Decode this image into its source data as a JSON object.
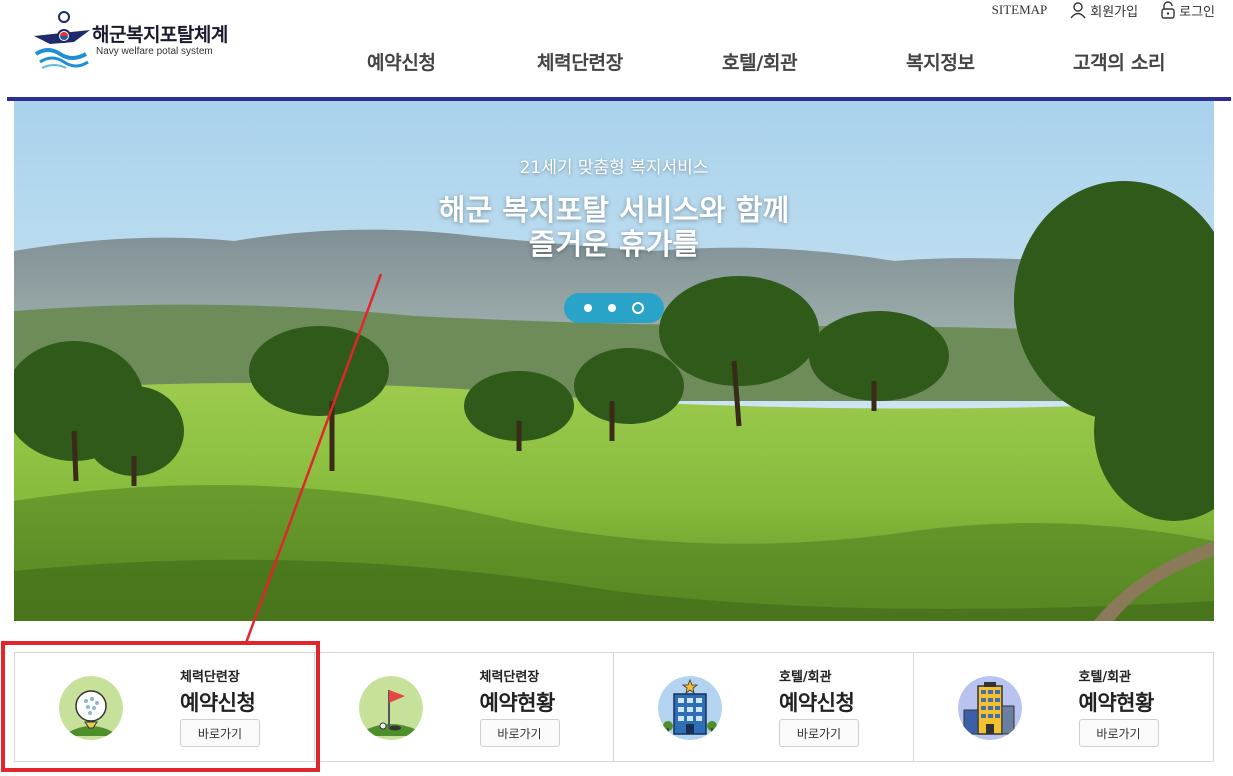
{
  "header": {
    "logo_title": "해군복지포탈체계",
    "logo_subtitle": "Navy welfare potal system",
    "util": {
      "sitemap": "SITEMAP",
      "join": "회원가입",
      "login": "로그인"
    },
    "gnb": [
      "예약신청",
      "체력단련장",
      "호텔/회관",
      "복지정보",
      "고객의 소리"
    ]
  },
  "hero": {
    "subtitle": "21세기 맞춤형 복지서비스",
    "title_line1": "해군 복지포탈 서비스와 함께",
    "title_line2": "즐거운 휴가를",
    "slides_total": 3,
    "slide_active": 3
  },
  "cards": [
    {
      "category": "체력단련장",
      "title": "예약신청",
      "button": "바로가기",
      "icon": "golf-ball-icon"
    },
    {
      "category": "체력단련장",
      "title": "예약현황",
      "button": "바로가기",
      "icon": "golf-flag-icon"
    },
    {
      "category": "호텔/회관",
      "title": "예약신청",
      "button": "바로가기",
      "icon": "hotel-building-icon"
    },
    {
      "category": "호텔/회관",
      "title": "예약현황",
      "button": "바로가기",
      "icon": "tower-building-icon"
    }
  ],
  "colors": {
    "nav_bar": "#2b2f8f",
    "slider_pill": "#2aa3c8",
    "annotation": "#e0262b"
  }
}
